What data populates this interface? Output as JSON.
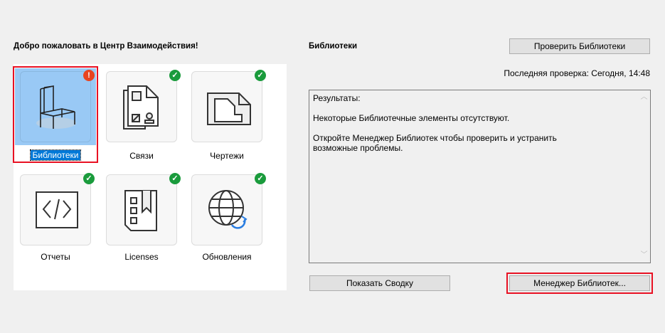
{
  "welcome_title": "Добро пожаловать в Центр Взаимодействия!",
  "tiles": [
    {
      "label": "Библиотеки",
      "status": "error",
      "icon": "chair-icon"
    },
    {
      "label": "Связи",
      "status": "ok",
      "icon": "linked-documents-icon"
    },
    {
      "label": "Чертежи",
      "status": "ok",
      "icon": "drawing-icon"
    },
    {
      "label": "Отчеты",
      "status": "ok",
      "icon": "code-icon"
    },
    {
      "label": "Licenses",
      "status": "ok",
      "icon": "license-icon"
    },
    {
      "label": "Обновления",
      "status": "ok",
      "icon": "globe-update-icon"
    }
  ],
  "badges": {
    "error": "!",
    "ok": "✓"
  },
  "details": {
    "title": "Библиотеки",
    "check_button": "Проверить Библиотеки",
    "last_check": "Последняя проверка: Сегодня, 14:48",
    "results": [
      "Результаты:",
      "Некоторые Библиотечные элементы отсутствуют.",
      "Откройте Менеджер Библиотек чтобы проверить и устранить возможные проблемы."
    ],
    "summary_button": "Показать Сводку",
    "manager_button": "Менеджер Библиотек..."
  },
  "colors": {
    "ok": "#1a9b3c",
    "error": "#e8431f",
    "selection": "#99c9f5",
    "highlight": "#e81123"
  }
}
